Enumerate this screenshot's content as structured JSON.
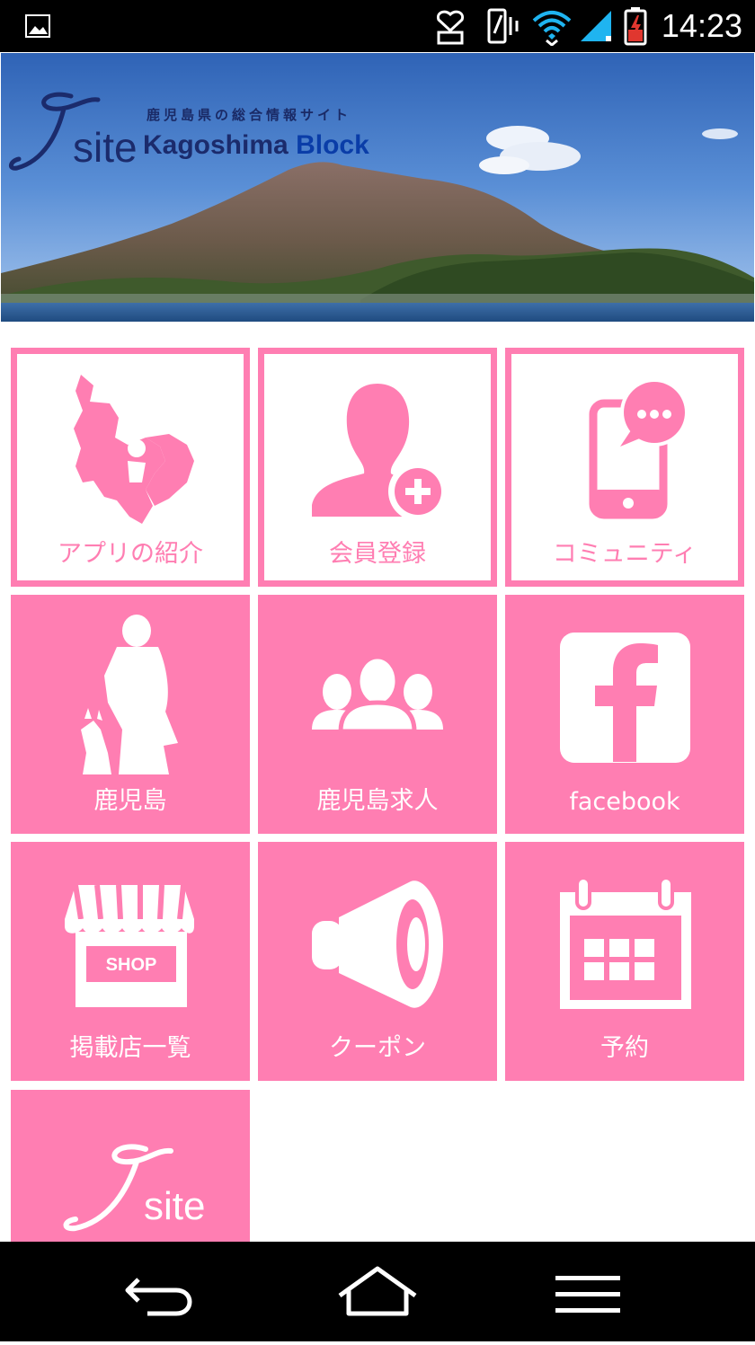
{
  "status_bar": {
    "time": "14:23",
    "icons": [
      "image-icon",
      "notification-icon",
      "vibrate-icon",
      "wifi-icon",
      "signal-icon",
      "battery-charging-icon"
    ]
  },
  "banner": {
    "subtitle": "鹿児島県の総合情報サイト",
    "logo_site": "site",
    "logo_kagoshima": "Kagoshima",
    "logo_block": "Block"
  },
  "tiles": [
    {
      "label": "アプリの紹介",
      "icon": "kagoshima-map-icon",
      "style": "outline"
    },
    {
      "label": "会員登録",
      "icon": "add-user-icon",
      "style": "outline"
    },
    {
      "label": "コミュニティ",
      "icon": "phone-chat-icon",
      "style": "outline"
    },
    {
      "label": "鹿児島",
      "icon": "saigo-statue-icon",
      "style": "solid"
    },
    {
      "label": "鹿児島求人",
      "icon": "people-group-icon",
      "style": "solid"
    },
    {
      "label": "facebook",
      "icon": "facebook-icon",
      "style": "solid"
    },
    {
      "label": "掲載店一覧",
      "icon": "shop-icon",
      "style": "solid"
    },
    {
      "label": "クーポン",
      "icon": "megaphone-icon",
      "style": "solid"
    },
    {
      "label": "予約",
      "icon": "calendar-icon",
      "style": "solid"
    },
    {
      "label": "",
      "icon": "isite-logo-icon",
      "style": "solid"
    }
  ],
  "shop_sign": "SHOP",
  "isite_logo_text": "site",
  "colors": {
    "accent": "#ff7eb2",
    "status_bar": "#000000",
    "logo_navy": "#1b2b6c"
  },
  "nav_bar": [
    "back-icon",
    "home-icon",
    "menu-icon"
  ]
}
